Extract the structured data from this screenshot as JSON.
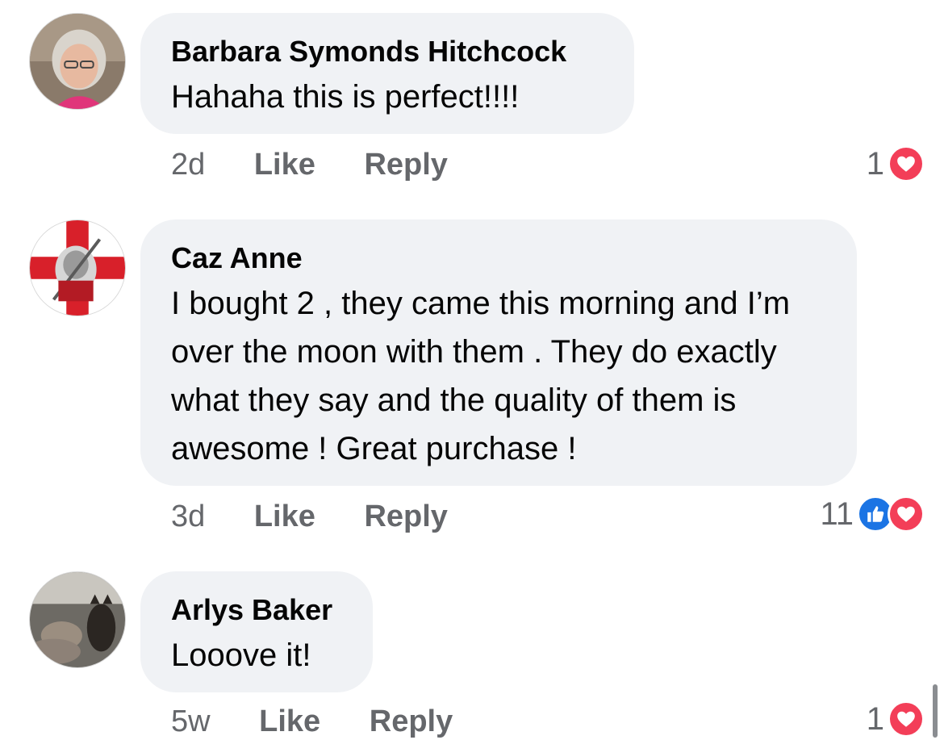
{
  "comments": [
    {
      "author": "Barbara Symonds Hitchcock",
      "text": "Hahaha this is perfect!!!!",
      "time": "2d",
      "like_label": "Like",
      "reply_label": "Reply",
      "reaction_count": "1",
      "reactions": [
        "love-icon"
      ]
    },
    {
      "author": "Caz Anne",
      "text": "I bought 2 , they came this morning and I’m over the moon with them . They do exactly what they say and the quality of them is awesome ! Great purchase !",
      "time": "3d",
      "like_label": "Like",
      "reply_label": "Reply",
      "reaction_count": "11",
      "reactions": [
        "like-icon",
        "love-icon"
      ]
    },
    {
      "author": "Arlys Baker",
      "text": "Looove it!",
      "time": "5w",
      "like_label": "Like",
      "reply_label": "Reply",
      "reaction_count": "1",
      "reactions": [
        "love-icon"
      ]
    }
  ],
  "colors": {
    "bubble_bg": "#f0f2f5",
    "secondary_text": "#65676b",
    "love_red": "#f33e58",
    "like_blue": "#1b74e4"
  }
}
